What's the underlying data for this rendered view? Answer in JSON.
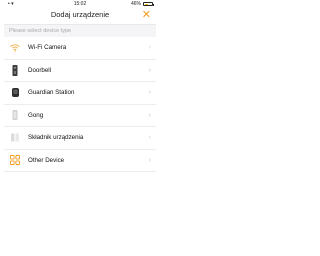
{
  "status": {
    "left": "• ▾",
    "time": "15:02",
    "battery_text": "46%",
    "battery_level": 0.46
  },
  "header": {
    "title": "Dodaj urządzenie",
    "close_glyph": "✕"
  },
  "section": {
    "placeholder": "Please select device type"
  },
  "items": [
    {
      "label": "Wi-Fi Camera",
      "icon": "wifi-icon"
    },
    {
      "label": "Doorbell",
      "icon": "doorbell-icon"
    },
    {
      "label": "Guardian Station",
      "icon": "guardian-station-icon"
    },
    {
      "label": "Gong",
      "icon": "gong-icon"
    },
    {
      "label": "Składnik urządzenia",
      "icon": "component-icon"
    },
    {
      "label": "Other Device",
      "icon": "grid-icon"
    }
  ],
  "chevron": "›",
  "colors": {
    "accent": "#f39b1f",
    "divider": "#ededed",
    "section_bg": "#f5f5f7"
  }
}
